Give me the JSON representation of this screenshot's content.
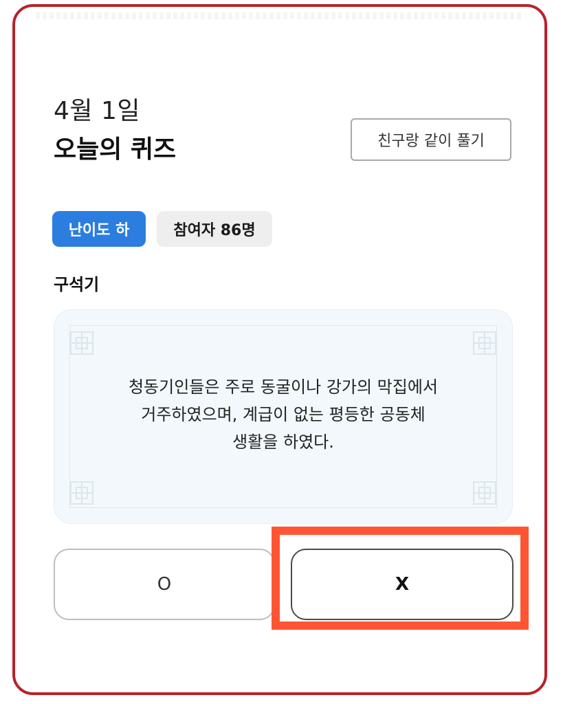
{
  "header": {
    "date": "4월 1일",
    "title": "오늘의 퀴즈",
    "share_button_label": "친구랑 같이 풀기"
  },
  "badges": {
    "difficulty": "난이도 하",
    "participants": "참여자 86명"
  },
  "quiz": {
    "category": "구석기",
    "question_lines": [
      "청동기인들은 주로 동굴이나 강가의 막집에서",
      "거주하였으며, 계급이 없는 평등한 공동체",
      "생활을 하였다."
    ]
  },
  "answers": {
    "o_label": "O",
    "x_label": "X"
  },
  "colors": {
    "card_border": "#b8222b",
    "difficulty_badge": "#2b7de0",
    "highlight": "#ff5533",
    "question_bg": "#f2f8fc"
  }
}
